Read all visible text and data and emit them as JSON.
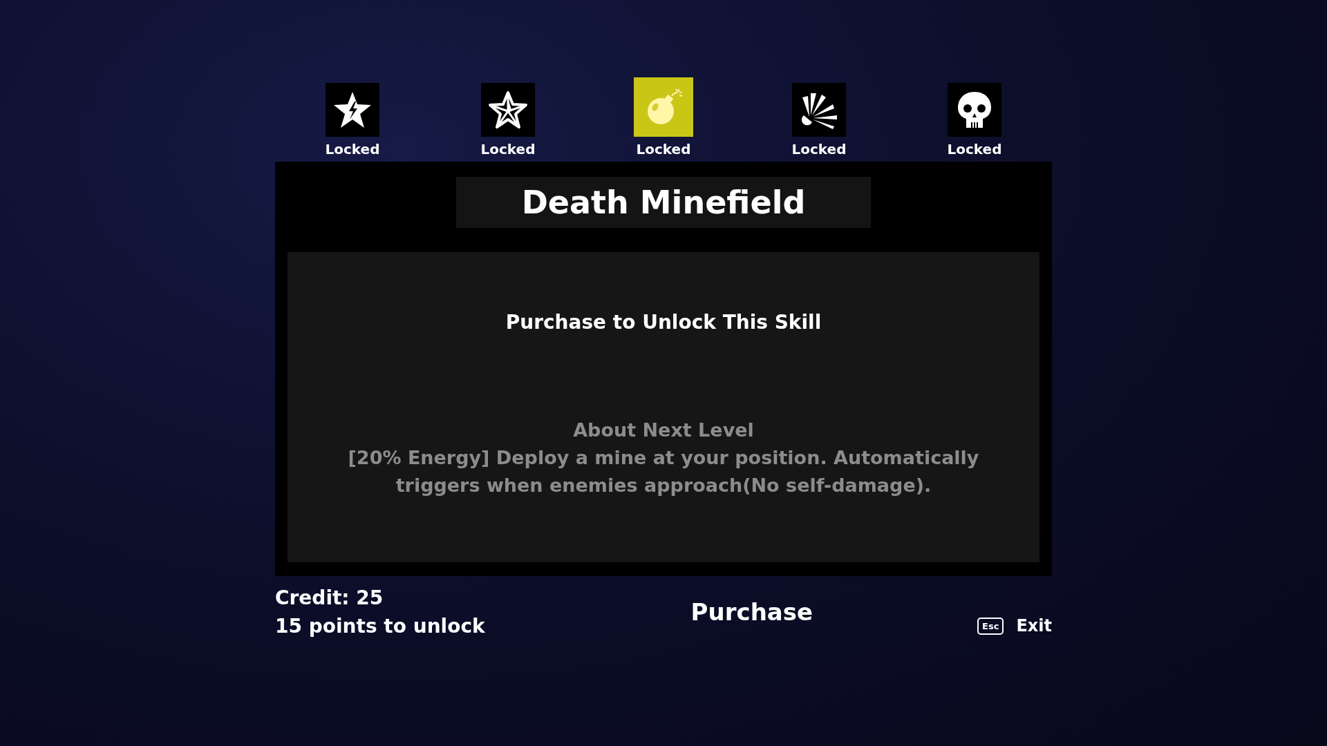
{
  "skills": [
    {
      "kind": "lightning-star",
      "status": "Locked",
      "selected": false
    },
    {
      "kind": "star",
      "status": "Locked",
      "selected": false
    },
    {
      "kind": "bomb",
      "status": "Locked",
      "selected": true
    },
    {
      "kind": "burst",
      "status": "Locked",
      "selected": false
    },
    {
      "kind": "skull",
      "status": "Locked",
      "selected": false
    }
  ],
  "panel": {
    "title": "Death Minefield",
    "unlock_text": "Purchase to Unlock This Skill",
    "next_level_heading": "About Next Level",
    "next_level_description": "[20% Energy] Deploy a mine at your position. Automatically triggers when enemies approach(No self-damage)."
  },
  "footer": {
    "credit": "Credit: 25",
    "points_needed": "15 points to unlock",
    "purchase_button": "Purchase",
    "exit_key": "Esc",
    "exit_label": "Exit"
  }
}
